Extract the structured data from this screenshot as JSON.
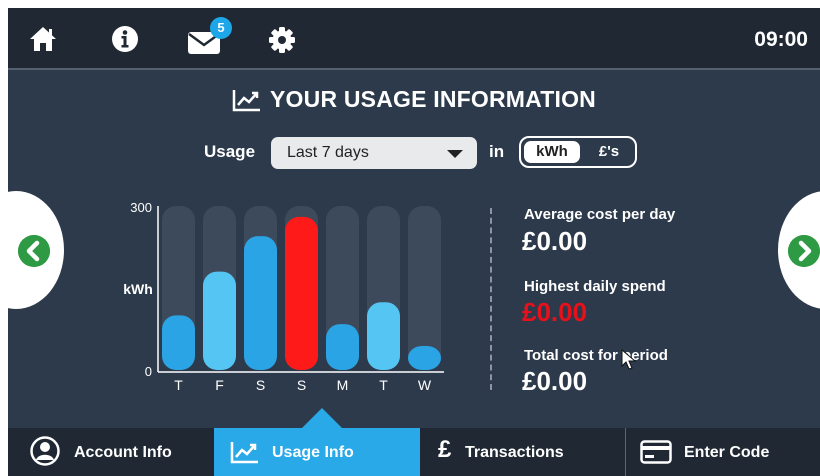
{
  "topbar": {
    "mail_badge_count": "5",
    "clock": "09:00",
    "icons": [
      "home-icon",
      "info-icon",
      "mail-icon",
      "gear-icon"
    ]
  },
  "title": "YOUR USAGE INFORMATION",
  "usage_controls": {
    "usage_label": "Usage",
    "period_selected": "Last 7 days",
    "in_label": "in",
    "unit_options": [
      "kWh",
      "£'s"
    ],
    "unit_selected": "kWh"
  },
  "chart_data": {
    "type": "bar",
    "categories": [
      "T",
      "F",
      "S",
      "S",
      "M",
      "T",
      "W"
    ],
    "values": [
      100,
      180,
      245,
      280,
      84,
      124,
      44
    ],
    "highlight_index": 3,
    "ylabel": "kWh",
    "ylim": [
      0,
      300
    ],
    "y_ticks": [
      "0",
      "300"
    ],
    "colors": {
      "track": "#3c4a5c",
      "bar_dark": "#2aa4e4",
      "bar_light": "#55c5f4",
      "highlight": "#ff1a1a",
      "axis": "#ffffff"
    }
  },
  "stats": {
    "avg_label": "Average cost per day",
    "avg_value": "£0.00",
    "highest_label": "Highest daily spend",
    "highest_value": "£0.00",
    "total_label": "Total cost for period",
    "total_value": "£0.00"
  },
  "nav": {
    "items": [
      {
        "label": "Account Info",
        "icon": "account-icon",
        "active": false
      },
      {
        "label": "Usage Info",
        "icon": "chart-icon",
        "active": true
      },
      {
        "label": "Transactions",
        "icon": "pound-icon",
        "active": false
      },
      {
        "label": "Enter Code",
        "icon": "card-icon",
        "active": false
      }
    ]
  },
  "colors": {
    "background": "#2c3a4b",
    "bar": "#1f2833",
    "accent": "#2aa9e8",
    "nav_arrow": "#2f9a44",
    "alert": "#e8101a"
  }
}
